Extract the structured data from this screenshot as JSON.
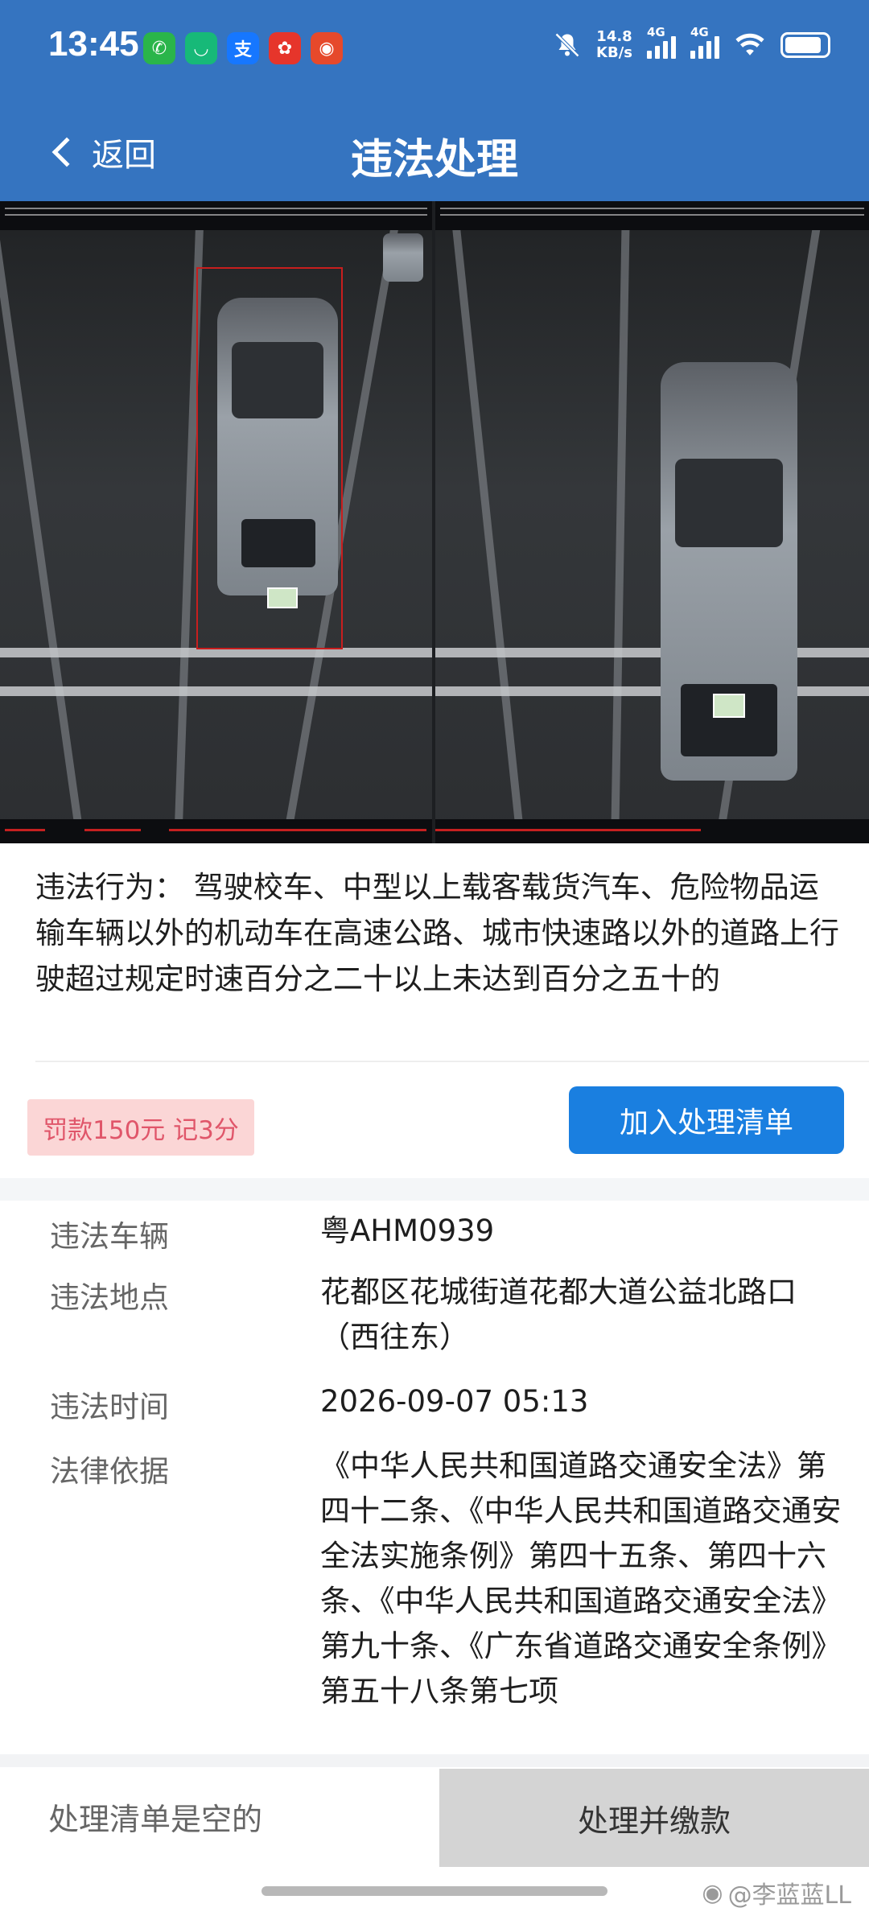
{
  "status_bar": {
    "time": "13:45",
    "apps": [
      {
        "icon": "wechat-icon",
        "glyph": "✆",
        "color": "#2ab54a"
      },
      {
        "icon": "meituan-icon",
        "glyph": "◡",
        "color": "#17b978"
      },
      {
        "icon": "alipay-icon",
        "glyph": "支",
        "color": "#1677ff"
      },
      {
        "icon": "app-red-icon",
        "glyph": "✿",
        "color": "#e6352b"
      },
      {
        "icon": "weibo-icon",
        "glyph": "◉",
        "color": "#e6492b"
      }
    ],
    "net_speed_value": "14.8",
    "net_speed_unit": "KB/s",
    "sim1_label": "4G",
    "sim2_label": "4G"
  },
  "nav": {
    "back_label": "返回",
    "title": "违法处理"
  },
  "violation": {
    "behavior_label": "违法行为：",
    "behavior_text": "驾驶校车、中型以上载客载货汽车、危险物品运输车辆以外的机动车在高速公路、城市快速路以外的道路上行驶超过规定时速百分之二十以上未达到百分之五十的",
    "penalty": "罚款150元 记3分",
    "add_button": "加入处理清单"
  },
  "details": [
    {
      "label": "违法车辆",
      "value": "粤AHM0939"
    },
    {
      "label": "违法地点",
      "value": "花都区花城街道花都大道公益北路口（西往东）"
    },
    {
      "label": "违法时间",
      "value": "2026-09-07 05:13"
    },
    {
      "label": "法律依据",
      "value": "《中华人民共和国道路交通安全法》第四十二条、《中华人民共和国道路交通安全法实施条例》第四十五条、第四十六条、《中华人民共和国道路交通安全法》第九十条、《广东省道路交通安全条例》第五十八条第七项"
    }
  ],
  "bottom": {
    "cart_status": "处理清单是空的",
    "pay_button": "处理并缴款"
  },
  "watermark": "@李蓝蓝LL"
}
